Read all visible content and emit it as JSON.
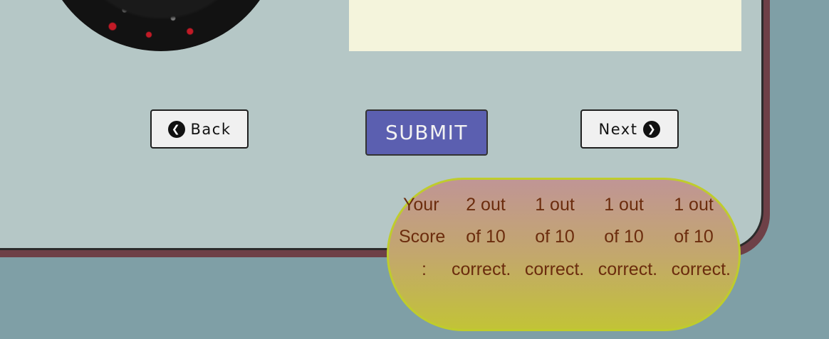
{
  "buttons": {
    "back_label": "Back",
    "submit_label": "SUBMIT",
    "next_label": "Next"
  },
  "icons": {
    "back": "chevron-left-circle-icon",
    "next": "chevron-right-circle-icon"
  },
  "score": {
    "label_line1": "Your",
    "label_line2": "Score",
    "colon": ":",
    "entries": [
      {
        "line1": "2 out",
        "line2": "of 10",
        "line3": "correct."
      },
      {
        "line1": "1 out",
        "line2": "of 10",
        "line3": "correct."
      },
      {
        "line1": "1 out",
        "line2": "of 10",
        "line3": "correct."
      },
      {
        "line1": "1 out",
        "line2": "of 10",
        "line3": "correct."
      }
    ]
  },
  "colors": {
    "background": "#7f9fa6",
    "card": "#b5c7c6",
    "card_shadow": "#6e4047",
    "submit": "#5b5fb0",
    "score_text": "#6b2c0d",
    "bubble_border": "#bfcc2c"
  }
}
